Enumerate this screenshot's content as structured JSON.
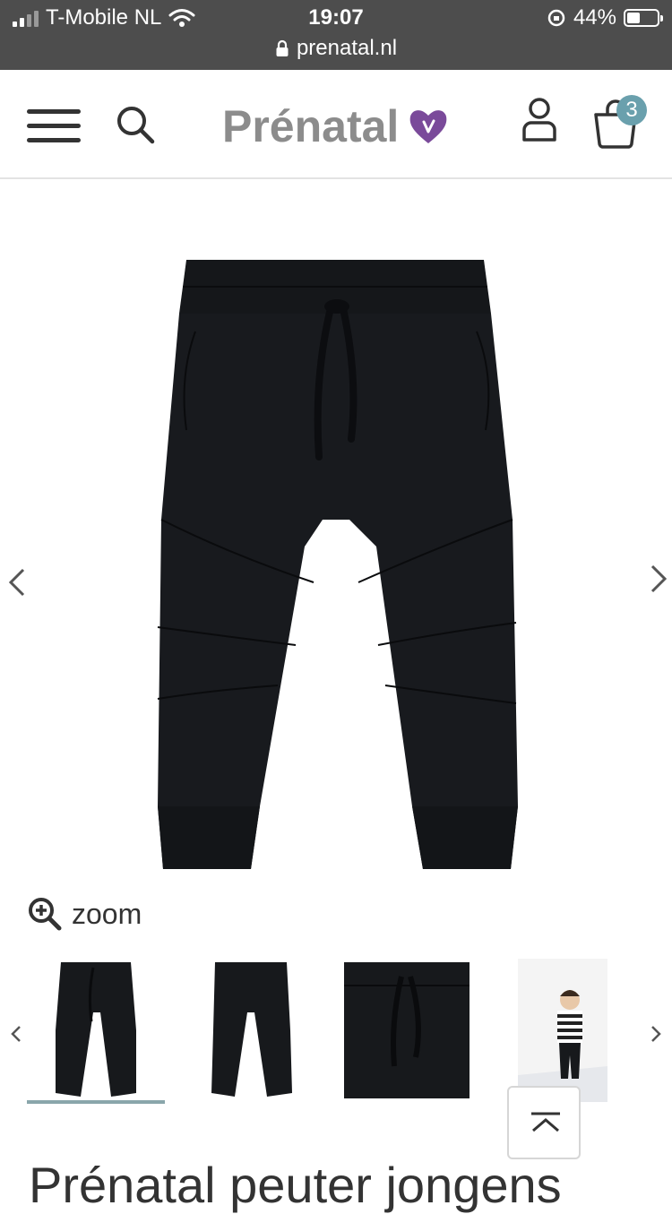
{
  "status_bar": {
    "carrier": "T-Mobile NL",
    "time": "19:07",
    "battery": "44%",
    "battery_level": 0.44,
    "url": "prenatal.nl"
  },
  "header": {
    "logo_text": "Prénatal",
    "cart_count": "3",
    "colors": {
      "logo_heart": "#7a4a9a",
      "badge": "#6aa0ad"
    }
  },
  "gallery": {
    "zoom_label": "zoom",
    "prev_icon": "chevron-left-icon",
    "next_icon": "chevron-right-icon"
  },
  "thumbnails": {
    "items": [
      {
        "name": "thumb-front"
      },
      {
        "name": "thumb-back"
      },
      {
        "name": "thumb-detail"
      },
      {
        "name": "thumb-model"
      }
    ],
    "selected_index": 0
  },
  "product": {
    "title": "Prénatal peuter jongens"
  }
}
